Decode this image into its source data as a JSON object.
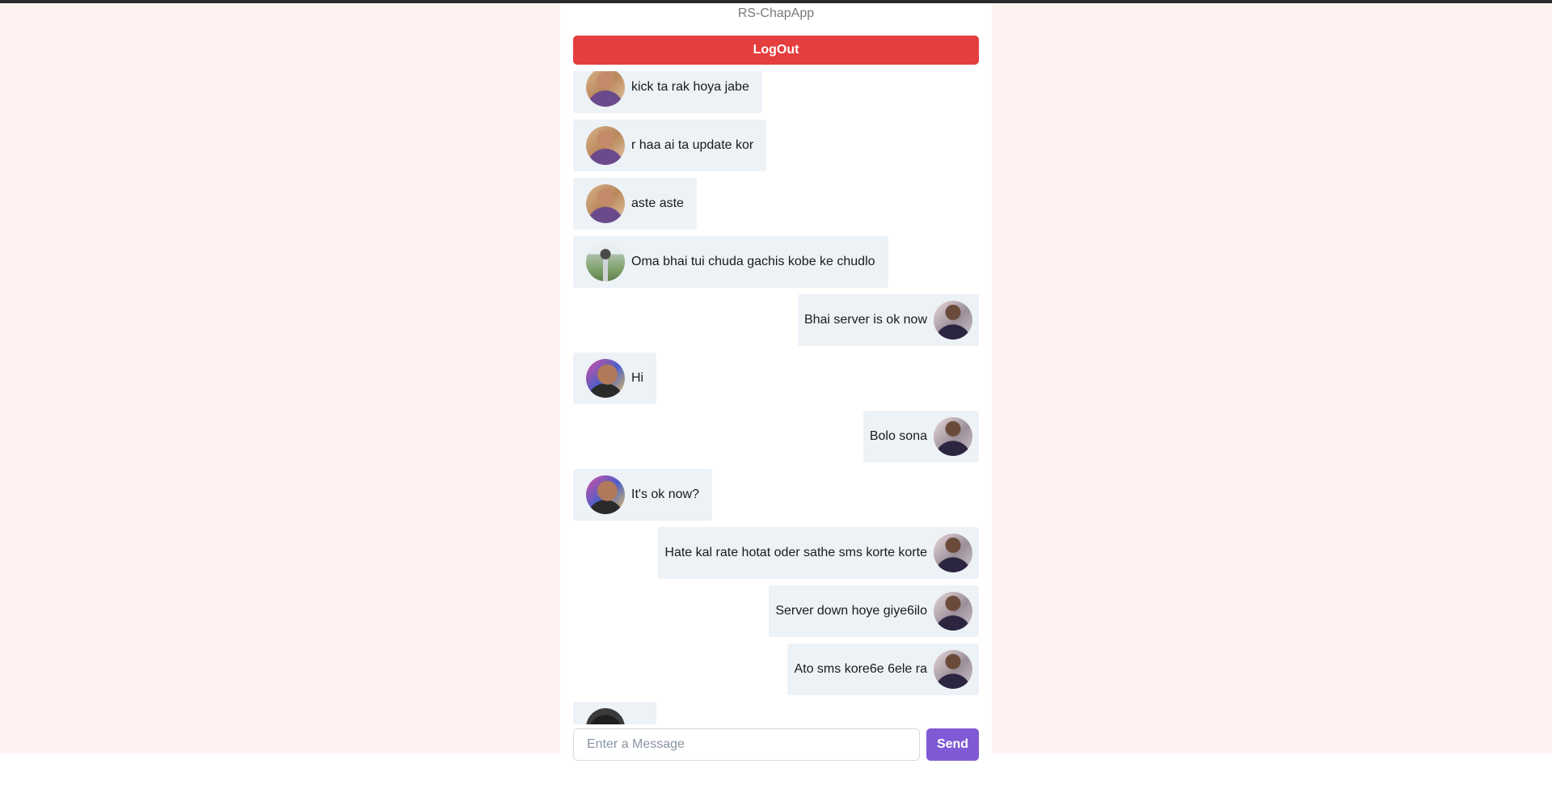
{
  "app": {
    "title": "RS-ChapApp",
    "logout_label": "LogOut"
  },
  "messages": [
    {
      "side": "left",
      "text": "kick ta rak hoya jabe",
      "avatar": "user-a-avatar"
    },
    {
      "side": "left",
      "text": "r haa ai ta update kor",
      "avatar": "user-a-avatar"
    },
    {
      "side": "left",
      "text": "aste aste",
      "avatar": "user-a-avatar"
    },
    {
      "side": "left",
      "text": "Oma bhai tui chuda gachis kobe ke chudlo",
      "avatar": "user-b-avatar"
    },
    {
      "side": "right",
      "text": "Bhai server is ok now",
      "avatar": "self-avatar"
    },
    {
      "side": "left",
      "text": "Hi",
      "avatar": "user-d-avatar"
    },
    {
      "side": "right",
      "text": "Bolo sona",
      "avatar": "self-avatar"
    },
    {
      "side": "left",
      "text": "It's ok now?",
      "avatar": "user-d-avatar"
    },
    {
      "side": "right",
      "text": "Hate kal rate hotat oder sathe sms korte korte",
      "avatar": "self-avatar"
    },
    {
      "side": "right",
      "text": "Server down hoye giye6ilo",
      "avatar": "self-avatar"
    },
    {
      "side": "right",
      "text": "Ato sms kore6e 6ele ra",
      "avatar": "self-avatar"
    },
    {
      "side": "left",
      "text": "",
      "avatar": "user-e-avatar"
    }
  ],
  "composer": {
    "placeholder": "Enter a Message",
    "value": "",
    "send_label": "Send"
  },
  "colors": {
    "page_background": "#fff3f1",
    "logout": "#e53e3e",
    "send": "#805ad5",
    "bubble": "#edf2f7"
  }
}
